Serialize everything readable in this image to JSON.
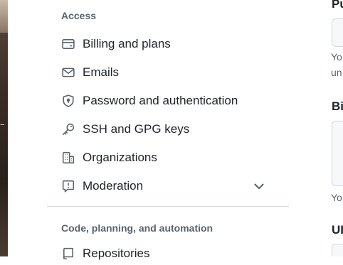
{
  "sidebar": {
    "sections": [
      {
        "heading": "Access",
        "items": [
          {
            "label": "Billing and plans",
            "icon": "credit-card-icon"
          },
          {
            "label": "Emails",
            "icon": "mail-icon"
          },
          {
            "label": "Password and authentication",
            "icon": "shield-lock-icon"
          },
          {
            "label": "SSH and GPG keys",
            "icon": "key-icon"
          },
          {
            "label": "Organizations",
            "icon": "organization-icon"
          },
          {
            "label": "Moderation",
            "icon": "report-icon",
            "expandable": true
          }
        ]
      },
      {
        "heading": "Code, planning, and automation",
        "items": [
          {
            "label": "Repositories",
            "icon": "repo-icon"
          }
        ]
      }
    ]
  },
  "right_panel": {
    "headings": [
      "Pu",
      "Bi",
      "UI"
    ],
    "texts": [
      "Yo",
      "un",
      "Yo"
    ]
  },
  "colors": {
    "heading_text": "#59636e",
    "body_text": "#1f2328",
    "divider": "#d1d9e0"
  }
}
